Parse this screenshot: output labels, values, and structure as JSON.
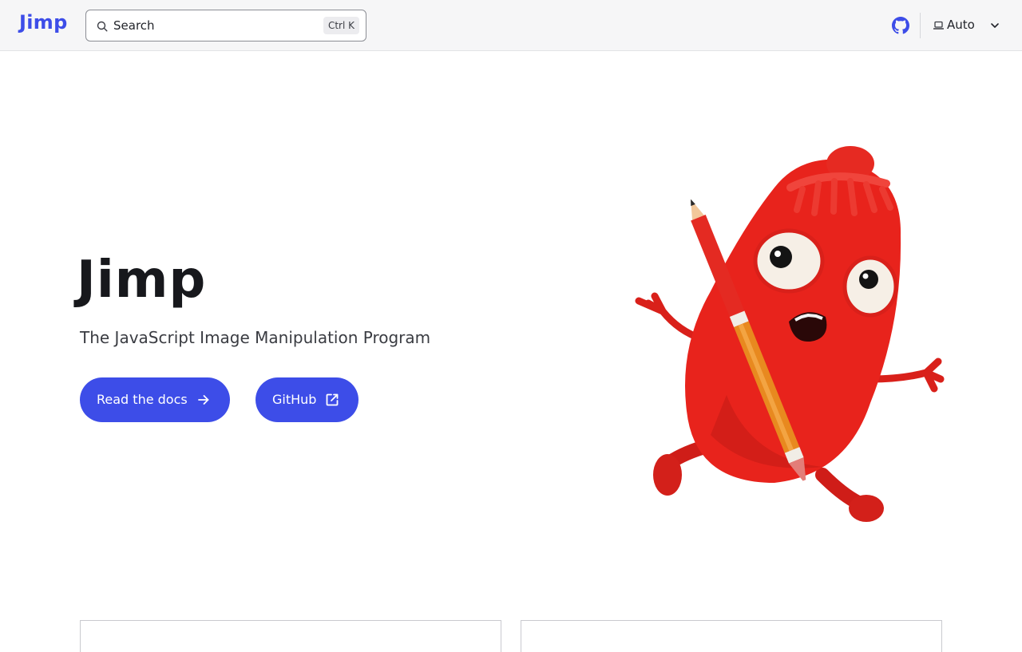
{
  "header": {
    "logo": "Jimp",
    "search": {
      "label": "Search",
      "shortcut": "Ctrl K"
    },
    "github_icon": "github-icon",
    "theme": {
      "icon": "laptop-icon",
      "label": "Auto",
      "chevron": "chevron-down-icon"
    }
  },
  "hero": {
    "title": "Jimp",
    "tagline": "The JavaScript Image Manipulation Program",
    "buttons": [
      {
        "label": "Read the docs",
        "icon": "arrow-right-icon"
      },
      {
        "label": "GitHub",
        "icon": "external-link-icon"
      }
    ],
    "image": "mascot-illustration"
  },
  "colors": {
    "accent": "#3d4de8",
    "header_bg": "#f6f6f7",
    "text": "#17181c",
    "mascot_red": "#e8231c",
    "pencil_orange": "#e8891f"
  }
}
